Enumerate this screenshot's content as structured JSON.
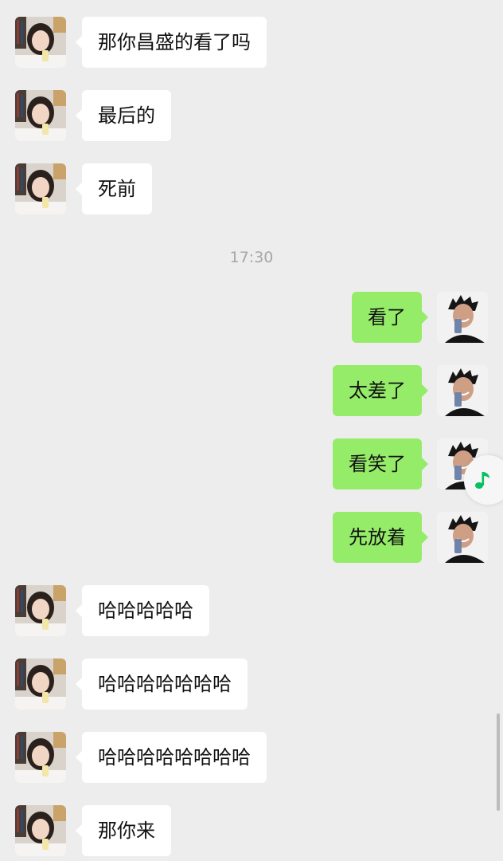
{
  "chat": {
    "timestamp": "17:30",
    "messages": [
      {
        "side": "left",
        "text": "那你昌盛的看了吗"
      },
      {
        "side": "left",
        "text": "最后的"
      },
      {
        "side": "left",
        "text": "死前"
      },
      {
        "side": "right",
        "text": "看了"
      },
      {
        "side": "right",
        "text": "太差了"
      },
      {
        "side": "right",
        "text": "看笑了"
      },
      {
        "side": "right",
        "text": "先放着"
      },
      {
        "side": "left",
        "text": "哈哈哈哈哈"
      },
      {
        "side": "left",
        "text": "哈哈哈哈哈哈哈"
      },
      {
        "side": "left",
        "text": "哈哈哈哈哈哈哈哈"
      },
      {
        "side": "left",
        "text": "那你来"
      }
    ]
  },
  "colors": {
    "background": "#ededed",
    "incoming_bubble": "#ffffff",
    "outgoing_bubble": "#95ec69",
    "timestamp_text": "#a6a6a6",
    "music_icon": "#07c160"
  },
  "icons": {
    "floating_widget": "music-note-icon"
  }
}
